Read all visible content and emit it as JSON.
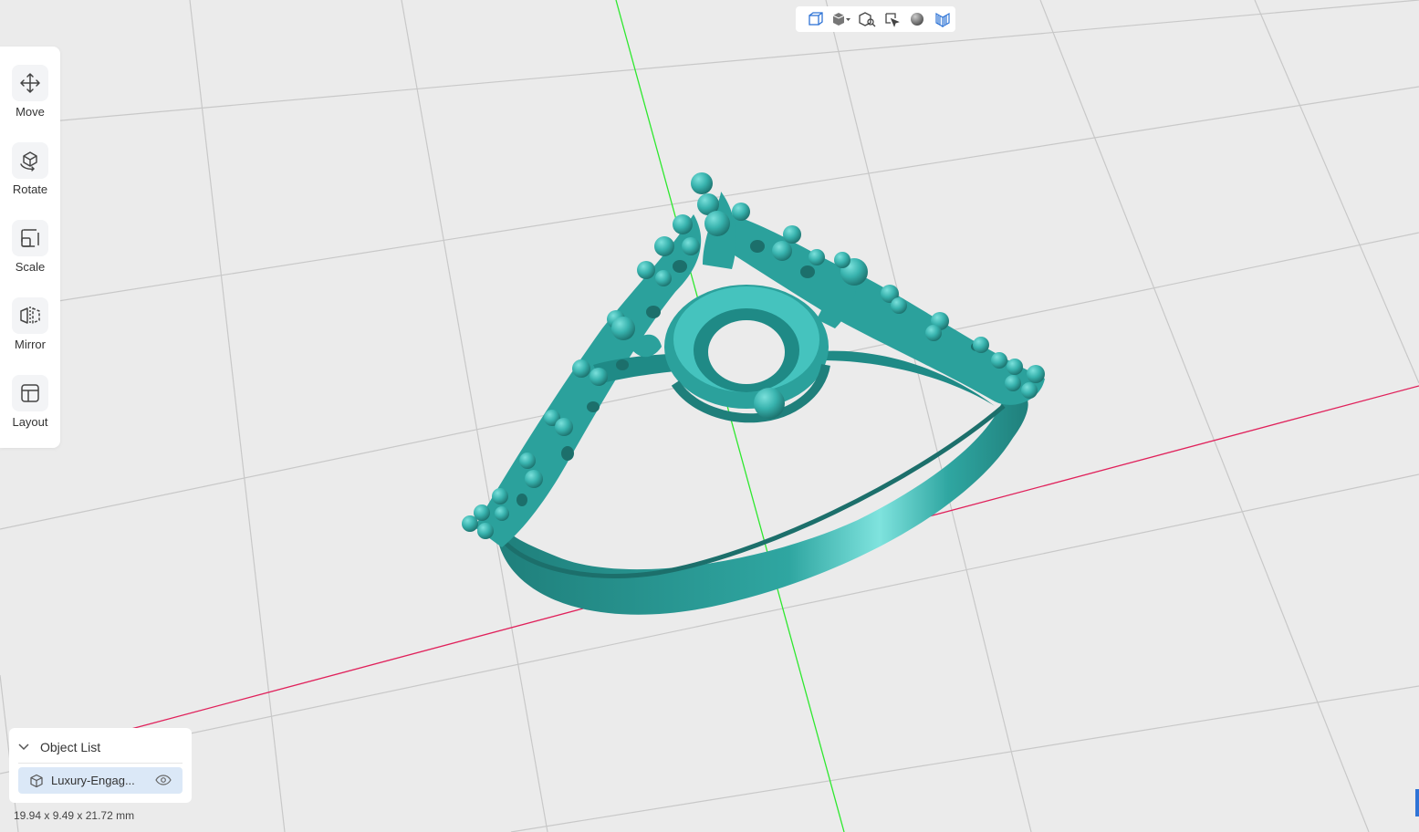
{
  "toolbar": {
    "items": [
      {
        "label": "Move",
        "icon": "move-icon"
      },
      {
        "label": "Rotate",
        "icon": "rotate-icon"
      },
      {
        "label": "Scale",
        "icon": "scale-icon"
      },
      {
        "label": "Mirror",
        "icon": "mirror-icon"
      },
      {
        "label": "Layout",
        "icon": "layout-icon"
      }
    ]
  },
  "viewbar": {
    "icons": [
      "view-cube-icon",
      "solid-view-dropdown-icon",
      "zoom-fit-icon",
      "select-view-icon",
      "material-sphere-icon",
      "wireframe-icon"
    ]
  },
  "object_list": {
    "title": "Object List",
    "items": [
      {
        "name": "Luxury-Engag..."
      }
    ]
  },
  "dimensions": "19.94 x 9.49 x 21.72 mm",
  "colors": {
    "background": "#ebebeb",
    "grid": "#c8c8c8",
    "axis_x": "#e0205a",
    "axis_y": "#2ee82e",
    "model": "#35b2ad",
    "accent": "#2f74d6"
  }
}
